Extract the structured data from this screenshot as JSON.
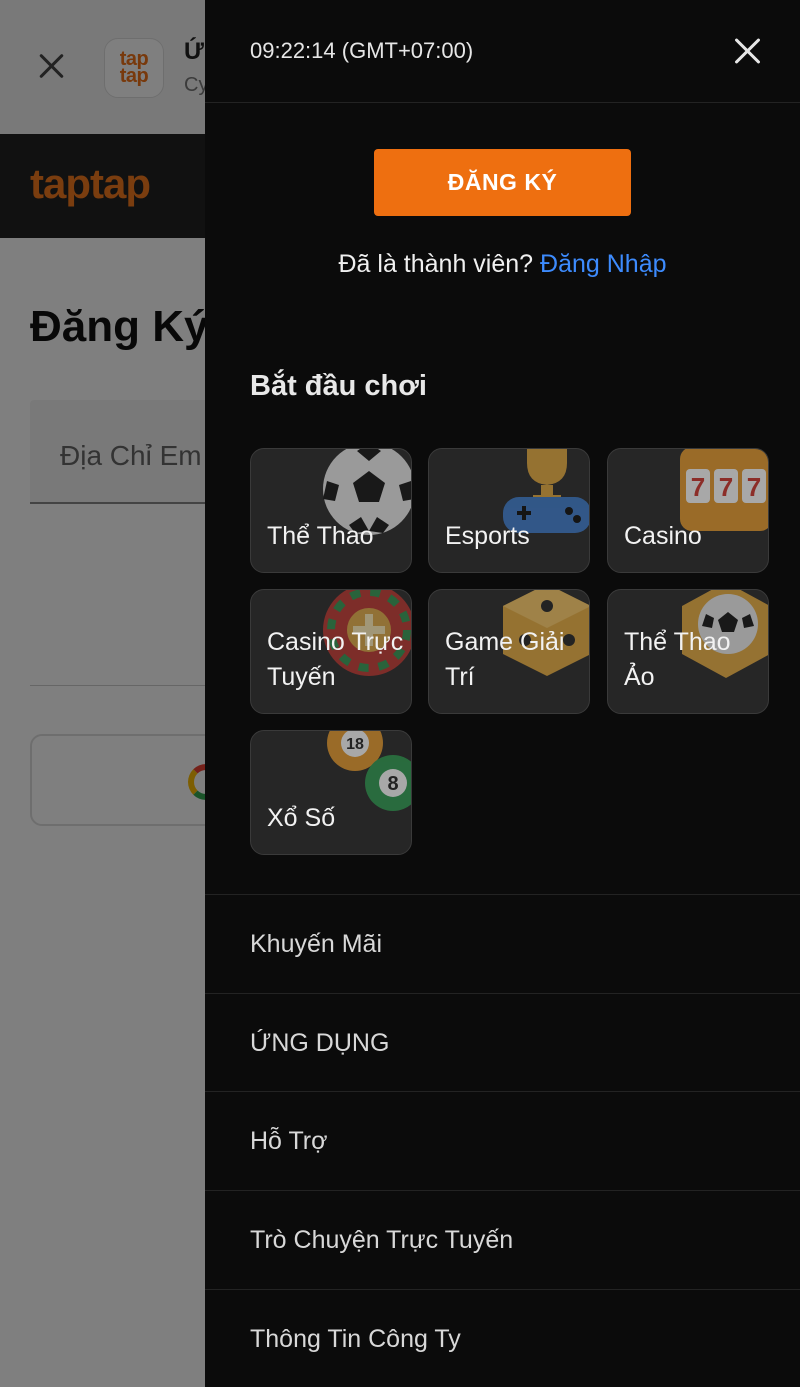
{
  "background": {
    "app_banner": {
      "icon_text_line1": "tap",
      "icon_text_line2": "tap",
      "title": "Ứ",
      "subtitle": "Cy"
    },
    "header": {
      "logo_text": "taptap"
    },
    "page_title": "Đăng Ký",
    "email_placeholder": "Địa Chỉ Em"
  },
  "drawer": {
    "clock": "09:22:14 (GMT+07:00)",
    "register_label": "ĐĂNG KÝ",
    "member_prompt": "Đã là thành viên?",
    "login_link": "Đăng Nhập",
    "section_title": "Bắt đầu chơi",
    "categories": [
      {
        "label": "Thể Thao",
        "icon": "soccer-ball-icon"
      },
      {
        "label": "Esports",
        "icon": "trophy-gamepad-icon"
      },
      {
        "label": "Casino",
        "icon": "slot-machine-icon"
      },
      {
        "label": "Casino Trực Tuyến",
        "icon": "roulette-icon"
      },
      {
        "label": "Game Giải Trí",
        "icon": "dice-icon"
      },
      {
        "label": "Thể Thao Ảo",
        "icon": "virtual-soccer-icon"
      },
      {
        "label": "Xổ Số",
        "icon": "lottery-balls-icon"
      }
    ],
    "menu": [
      {
        "label": "Khuyến Mãi"
      },
      {
        "label": "ỨNG DỤNG"
      },
      {
        "label": "Hỗ Trợ"
      },
      {
        "label": "Trò Chuyện Trực Tuyến"
      },
      {
        "label": "Thông Tin Công Ty"
      }
    ]
  },
  "colors": {
    "accent_orange": "#ee6f10",
    "link_blue": "#3d8bfd",
    "drawer_bg": "#0b0b0b",
    "tile_bg": "#262626"
  }
}
